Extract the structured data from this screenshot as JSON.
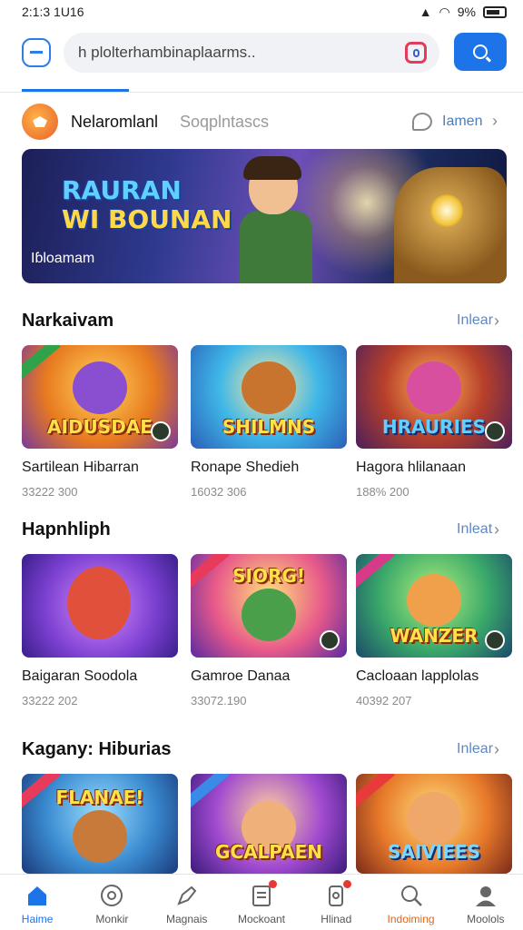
{
  "status_bar": {
    "time": "2:1:3 1U16",
    "battery": "9%"
  },
  "search": {
    "query": "h plolterhambinaplaarms..",
    "placeholder": ""
  },
  "brand": {
    "name": "Nelaromlanl",
    "subtitle": "Soqplntascs",
    "link": "Iamen"
  },
  "banner": {
    "title_line1": "RAURAN",
    "title_line2": "WI BOUNAN",
    "caption": "Iɓloamam"
  },
  "sections": [
    {
      "title": "Narkaivam",
      "link": "Inlear",
      "cards": [
        {
          "title": "Sartilean Hibarran",
          "meta": "33222 300",
          "art": "AIDUSDAE"
        },
        {
          "title": "Ronape Shedieh",
          "meta": "16032 306",
          "art": "SHILMNS"
        },
        {
          "title": "Hagora hlilanaan",
          "meta": "188% 200",
          "art": "HRAURIES"
        }
      ]
    },
    {
      "title": "Hapnhliph",
      "link": "Inleat",
      "cards": [
        {
          "title": "Baigaran Soodola",
          "meta": "33222 202",
          "art": ""
        },
        {
          "title": "Gamroe Danaa",
          "meta": "33072.190",
          "art": "SIORG!"
        },
        {
          "title": "Cacloaan lapplolas",
          "meta": "40392 207",
          "art": "WANZER"
        }
      ]
    },
    {
      "title": "Kagany: Hiburias",
      "link": "Inlear",
      "cards": [
        {
          "title": "",
          "meta": "",
          "art": "FLANAE!"
        },
        {
          "title": "",
          "meta": "",
          "art": "GCALPAEN"
        },
        {
          "title": "",
          "meta": "",
          "art": "SAIVIEES"
        }
      ]
    }
  ],
  "nav": [
    {
      "label": "Haime",
      "icon": "home-icon"
    },
    {
      "label": "Monkir",
      "icon": "compass-icon"
    },
    {
      "label": "Magnais",
      "icon": "edit-icon"
    },
    {
      "label": "Mockoant",
      "icon": "document-icon"
    },
    {
      "label": "Hlinad",
      "icon": "phone-icon"
    },
    {
      "label": "Indoiming",
      "icon": "search-icon"
    },
    {
      "label": "Moolols",
      "icon": "profile-icon"
    }
  ],
  "colors": {
    "accent": "#1d74e8",
    "link": "#5d88c8",
    "active_orange": "#e0661a"
  }
}
